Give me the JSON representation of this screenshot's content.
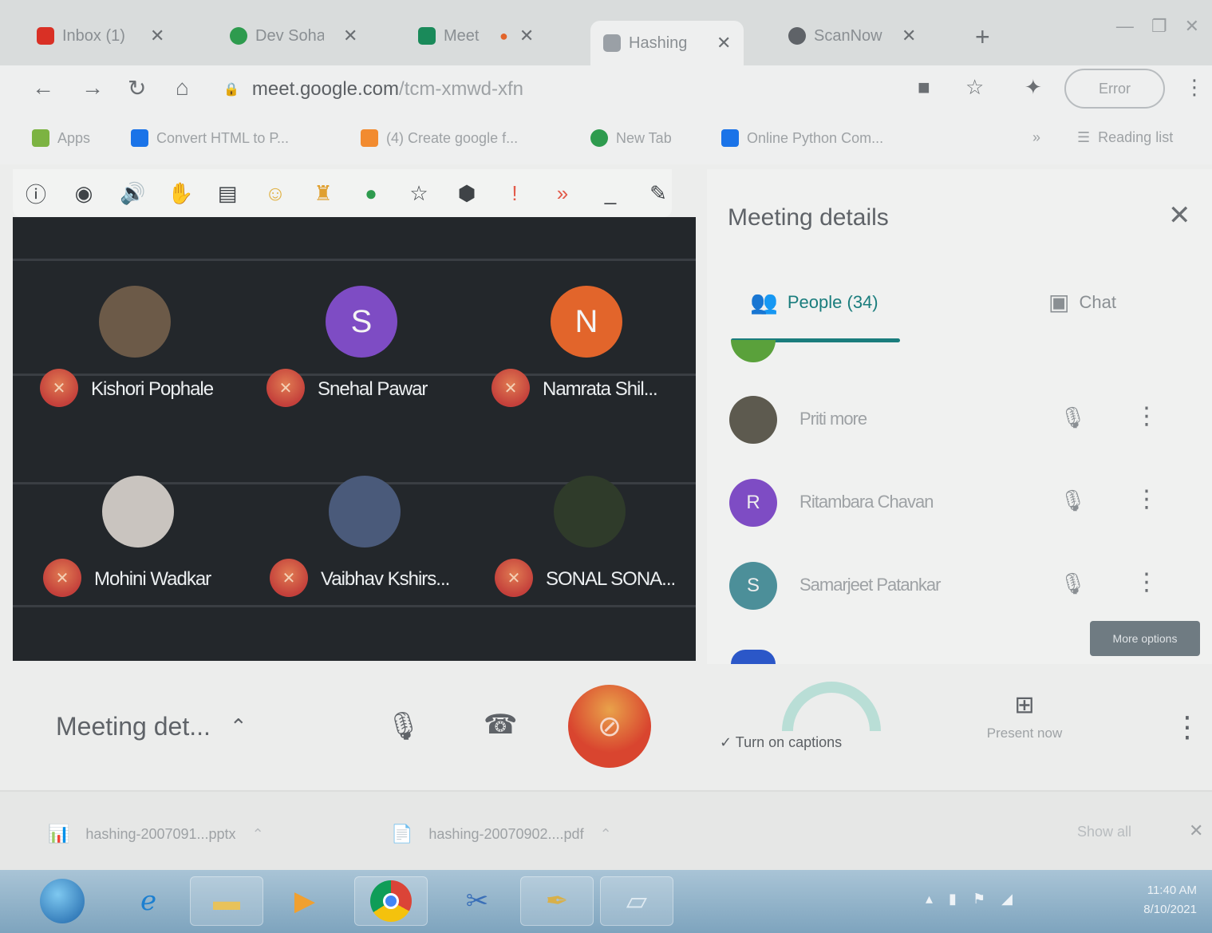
{
  "browser": {
    "tabs": [
      {
        "label": "Inbox (1)",
        "color": "#d93025",
        "close": "✕"
      },
      {
        "label": "Dev Sohai",
        "color": "#2e9b4e",
        "close": "✕"
      },
      {
        "label": "Meet",
        "color": "#1a8a5a",
        "close": "✕"
      },
      {
        "label": "Hashing",
        "color": "#9aa0a6",
        "close": "✕"
      },
      {
        "label": "ScanNow",
        "color": "#5f6368",
        "close": "✕"
      }
    ],
    "new_tab": "+",
    "url_host": "meet.google.com",
    "url_path": "/tcm-xmwd-xfn",
    "profile_label": "Error",
    "bookmarks": [
      {
        "label": "Apps",
        "color": "#7cb342"
      },
      {
        "label": "Convert HTML to P...",
        "color": "#1a73e8"
      },
      {
        "label": "(4) Create google f...",
        "color": "#f28b30"
      },
      {
        "label": "New Tab",
        "color": "#2e9b4e"
      },
      {
        "label": "Online Python Com...",
        "color": "#1a73e8"
      }
    ],
    "reading_list": "Reading list"
  },
  "participants": [
    {
      "name": "Kishori Pophale",
      "initial": "",
      "avatar_color": "#6c5a48"
    },
    {
      "name": "Snehal Pawar",
      "initial": "S",
      "avatar_color": "#7e4cc4"
    },
    {
      "name": "Namrata Shil...",
      "initial": "N",
      "avatar_color": "#e2652b"
    },
    {
      "name": "Mohini Wadkar",
      "initial": "",
      "avatar_color": "#c9c4bf"
    },
    {
      "name": "Vaibhav Kshirs...",
      "initial": "",
      "avatar_color": "#4a5a7a"
    },
    {
      "name": "SONAL SONA...",
      "initial": "",
      "avatar_color": "#2f3b2a"
    }
  ],
  "panel": {
    "title": "Meeting details",
    "people_tab": "People (34)",
    "chat_tab": "Chat",
    "people": [
      {
        "name": "Priti more",
        "initial": "",
        "avatar_color": "#5d5a4f"
      },
      {
        "name": "Ritambara Chavan",
        "initial": "R",
        "avatar_color": "#7e4cc4"
      },
      {
        "name": "Samarjeet Patankar",
        "initial": "S",
        "avatar_color": "#4c8f99"
      }
    ],
    "tooltip": "More options"
  },
  "callbar": {
    "meeting_details": "Meeting det...",
    "captions": "Turn on captions",
    "present": "Present now"
  },
  "downloads": [
    {
      "label": "hashing-2007091...pptx",
      "icon": "📊"
    },
    {
      "label": "hashing-20070902....pdf",
      "icon": "📄"
    }
  ],
  "show_all": "Show all",
  "clock": {
    "time": "11:40 AM",
    "date": "8/10/2021"
  }
}
